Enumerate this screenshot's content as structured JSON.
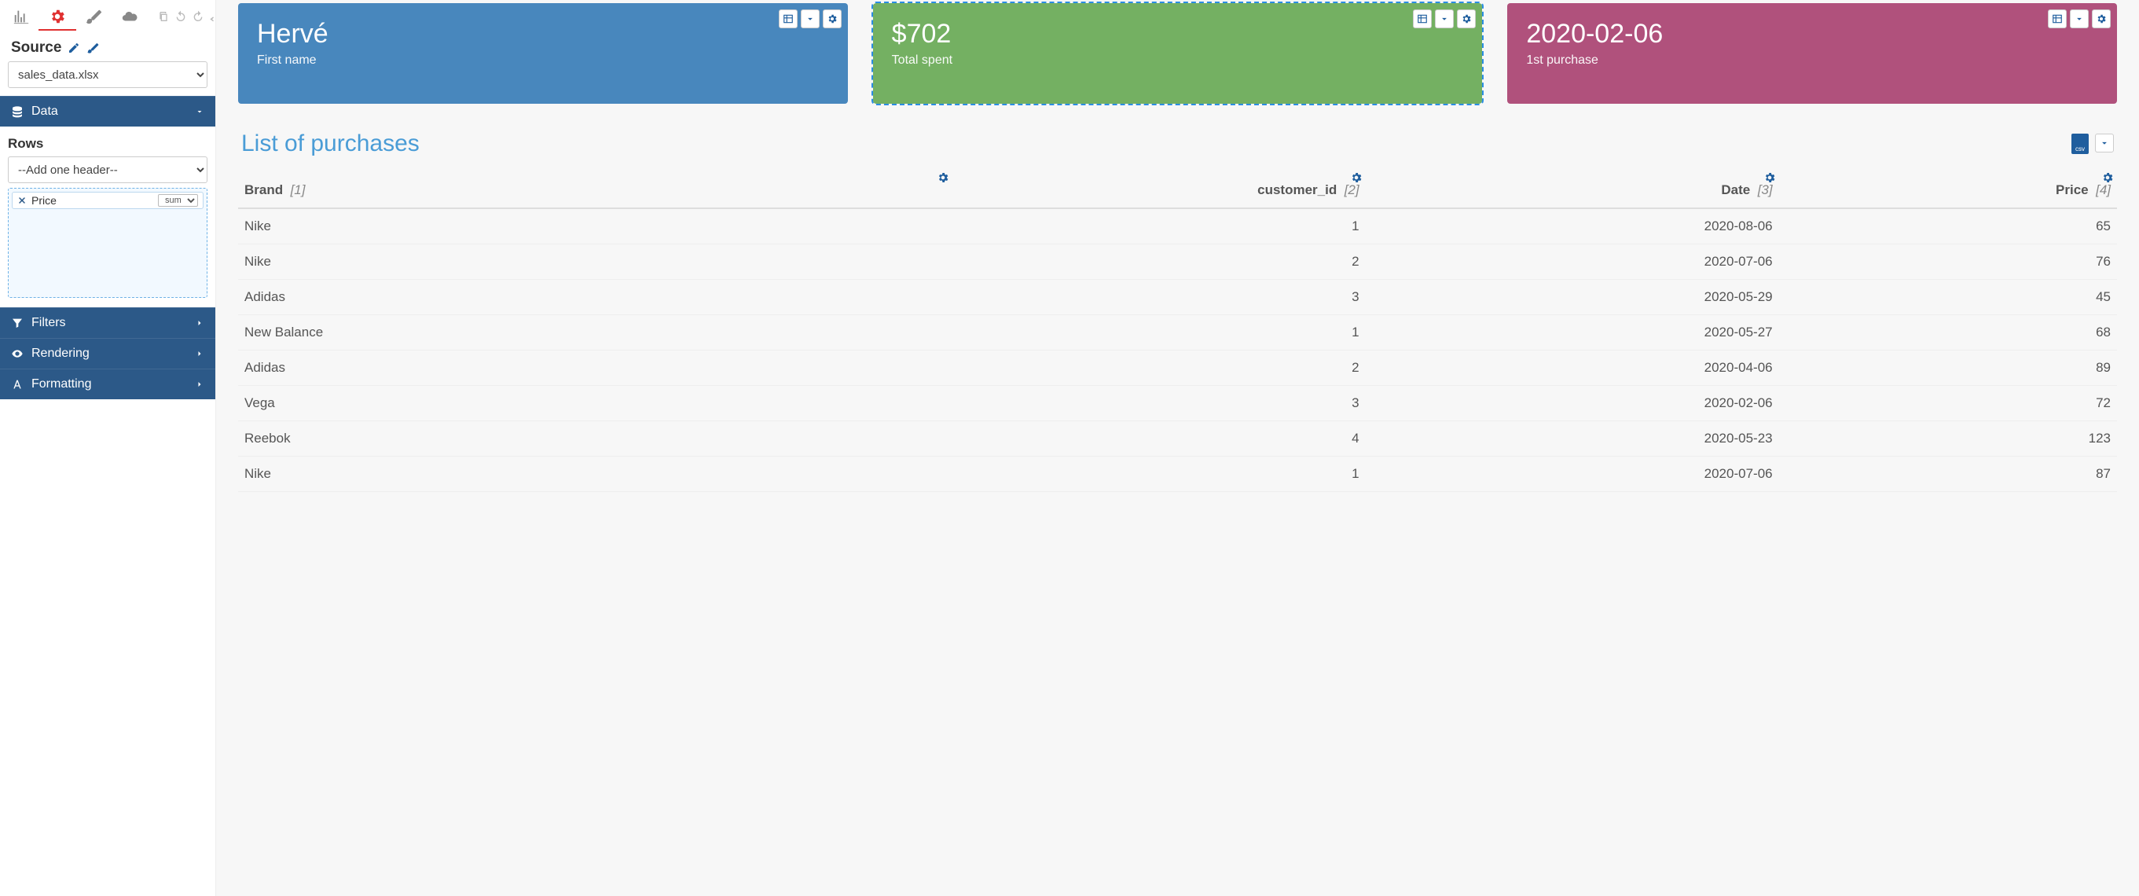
{
  "sidebar": {
    "source_label": "Source",
    "source_select_value": "sales_data.xlsx",
    "accordion": {
      "data": "Data",
      "filters": "Filters",
      "rendering": "Rendering",
      "formatting": "Formatting"
    },
    "rows_label": "Rows",
    "rows_select_placeholder": "--Add one header--",
    "row_chip": {
      "field": "Price",
      "agg": "sum"
    }
  },
  "cards": {
    "first_name": {
      "value": "Hervé",
      "label": "First name"
    },
    "total_spent": {
      "value": "$702",
      "label": "Total spent"
    },
    "first_purchase": {
      "value": "2020-02-06",
      "label": "1st purchase"
    }
  },
  "list": {
    "title": "List of purchases",
    "columns": {
      "brand": {
        "label": "Brand",
        "idx": "[1]"
      },
      "cust": {
        "label": "customer_id",
        "idx": "[2]"
      },
      "date": {
        "label": "Date",
        "idx": "[3]"
      },
      "price": {
        "label": "Price",
        "idx": "[4]"
      }
    },
    "rows": [
      {
        "brand": "Nike",
        "cust": "1",
        "date": "2020-08-06",
        "price": "65"
      },
      {
        "brand": "Nike",
        "cust": "2",
        "date": "2020-07-06",
        "price": "76"
      },
      {
        "brand": "Adidas",
        "cust": "3",
        "date": "2020-05-29",
        "price": "45"
      },
      {
        "brand": "New Balance",
        "cust": "1",
        "date": "2020-05-27",
        "price": "68"
      },
      {
        "brand": "Adidas",
        "cust": "2",
        "date": "2020-04-06",
        "price": "89"
      },
      {
        "brand": "Vega",
        "cust": "3",
        "date": "2020-02-06",
        "price": "72"
      },
      {
        "brand": "Reebok",
        "cust": "4",
        "date": "2020-05-23",
        "price": "123"
      },
      {
        "brand": "Nike",
        "cust": "1",
        "date": "2020-07-06",
        "price": "87"
      }
    ]
  },
  "colors": {
    "blue": "#4887bd",
    "green": "#74b062",
    "plum": "#b0517c",
    "accent": "#1f5e9e"
  }
}
